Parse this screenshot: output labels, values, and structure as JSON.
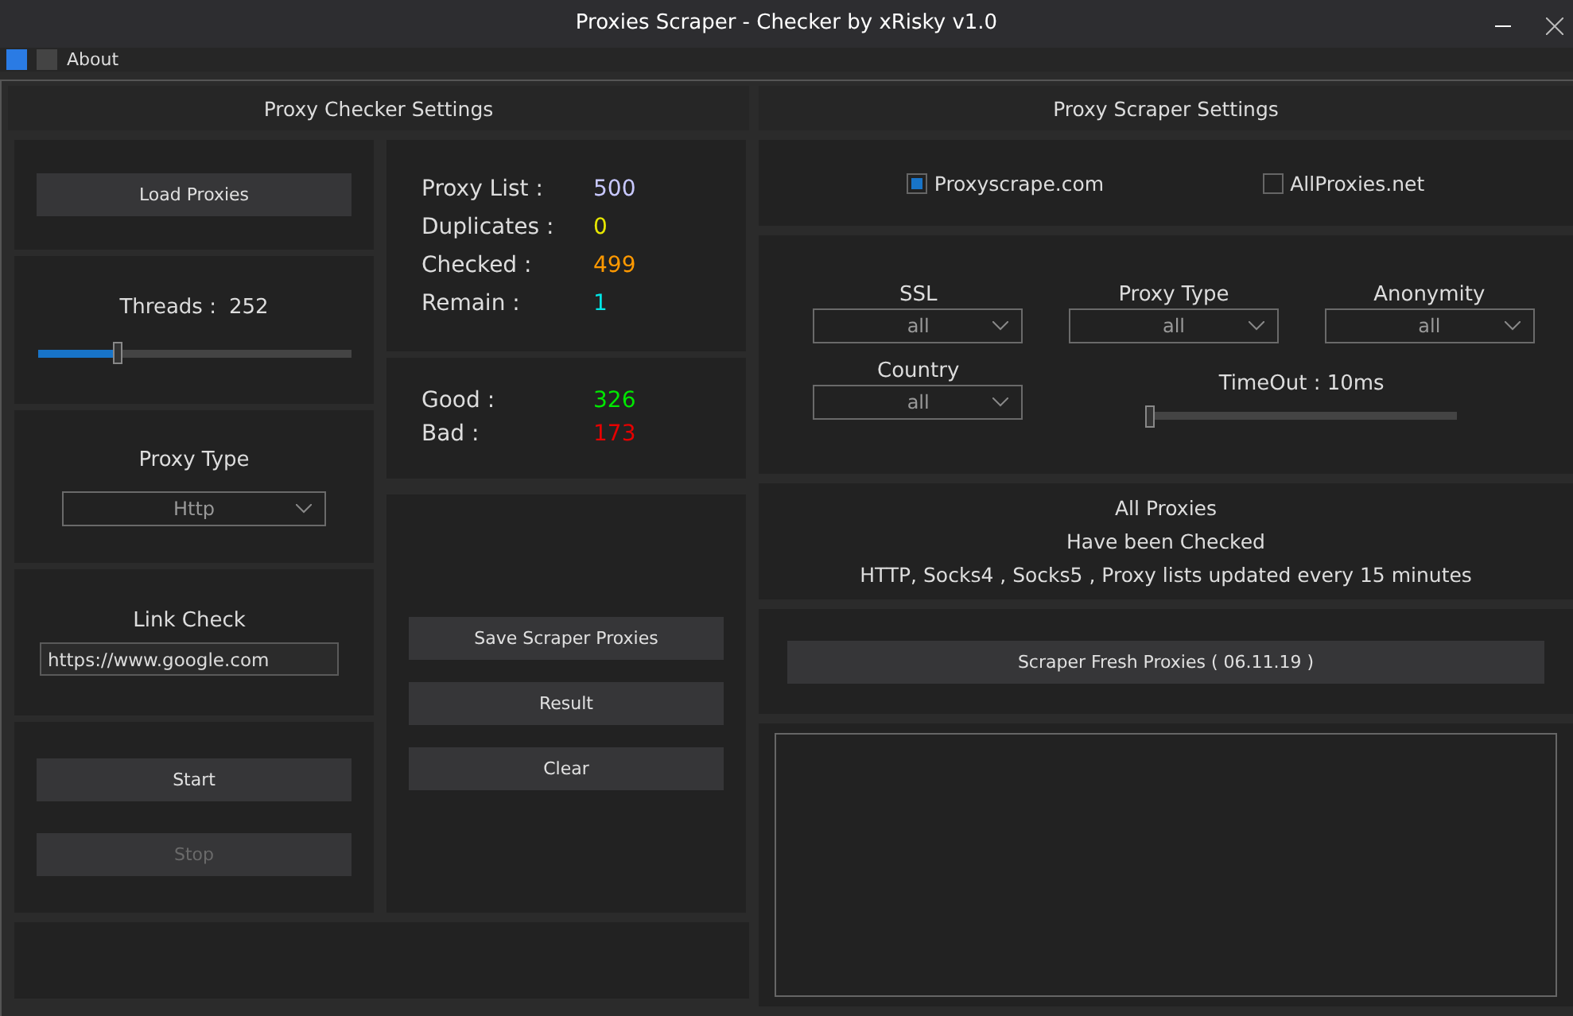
{
  "window": {
    "title": "Proxies Scraper - Checker by xRisky v1.0"
  },
  "menu": {
    "items": [
      "About"
    ]
  },
  "checker": {
    "title": "Proxy Checker Settings",
    "load_button": "Load Proxies",
    "threads": {
      "label": "Threads :",
      "value": "252",
      "level": 0.25
    },
    "proxy_type": {
      "label": "Proxy Type",
      "value": "Http"
    },
    "link_check": {
      "label": "Link Check",
      "value": "https://www.google.com"
    },
    "start_button": {
      "label": "Start",
      "disabled": false
    },
    "stop_button": {
      "label": "Stop",
      "disabled": true
    },
    "stats": [
      {
        "label": "Proxy List :",
        "value": "500",
        "color": "#c8c8ff"
      },
      {
        "label": "Duplicates :",
        "value": "0",
        "color": "#e6e600"
      },
      {
        "label": "Checked :",
        "value": "499",
        "color": "#ff9900"
      },
      {
        "label": "Remain :",
        "value": "1",
        "color": "#00e6e6"
      }
    ],
    "results": [
      {
        "label": "Good :",
        "value": "326",
        "color": "#00e600"
      },
      {
        "label": "Bad :",
        "value": "173",
        "color": "#e60000"
      }
    ],
    "actions": [
      "Save Scraper Proxies",
      "Result",
      "Clear"
    ]
  },
  "scraper": {
    "title": "Proxy Scraper Settings",
    "sources": [
      {
        "label": "Proxyscrape.com",
        "checked": true
      },
      {
        "label": "AllProxies.net",
        "checked": false
      }
    ],
    "filters": [
      {
        "label": "SSL",
        "value": "all"
      },
      {
        "label": "Proxy Type",
        "value": "all"
      },
      {
        "label": "Anonymity",
        "value": "all"
      },
      {
        "label": "Country",
        "value": "all"
      }
    ],
    "timeout": {
      "label": "TimeOut : 10ms",
      "level": 0
    },
    "info": [
      "All Proxies",
      "Have been Checked",
      "HTTP, Socks4 , Socks5  , Proxy lists updated every 15 minutes"
    ],
    "scrape_button": "Scraper Fresh Proxies ( 06.11.19 )"
  }
}
